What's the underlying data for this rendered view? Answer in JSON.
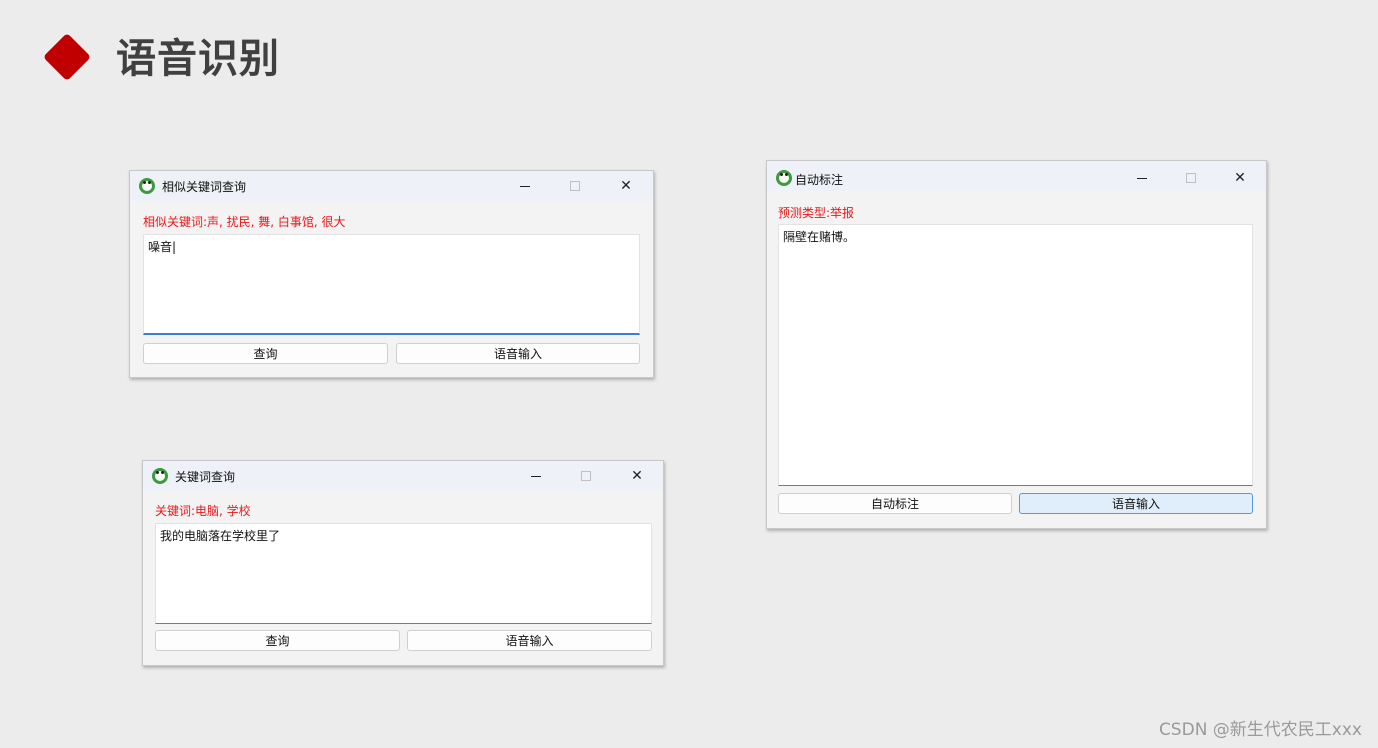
{
  "slide": {
    "title": "语音识别"
  },
  "windows": [
    {
      "title": "相似关键词查询",
      "result": "相似关键词:声, 扰民, 舞, 白事馆, 很大",
      "text": "噪音|",
      "buttons": [
        "查询",
        "语音输入"
      ]
    },
    {
      "title": "关键词查询",
      "result": "关键词:电脑, 学校",
      "text": "我的电脑落在学校里了",
      "buttons": [
        "查询",
        "语音输入"
      ]
    },
    {
      "title": "自动标注",
      "result": "预测类型:举报",
      "text": "隔壁在赌博。",
      "buttons": [
        "自动标注",
        "语音输入"
      ]
    }
  ],
  "controls": {
    "close_glyph": "✕"
  },
  "watermark": "CSDN @新生代农民工xxx",
  "colors": {
    "accent_red": "#c00000",
    "result_red": "#e8191b",
    "focus_blue": "#3c7dd6"
  },
  "icons": [
    "panda-app-icon",
    "minimize-icon",
    "maximize-icon",
    "close-icon",
    "diamond-bullet-icon"
  ]
}
